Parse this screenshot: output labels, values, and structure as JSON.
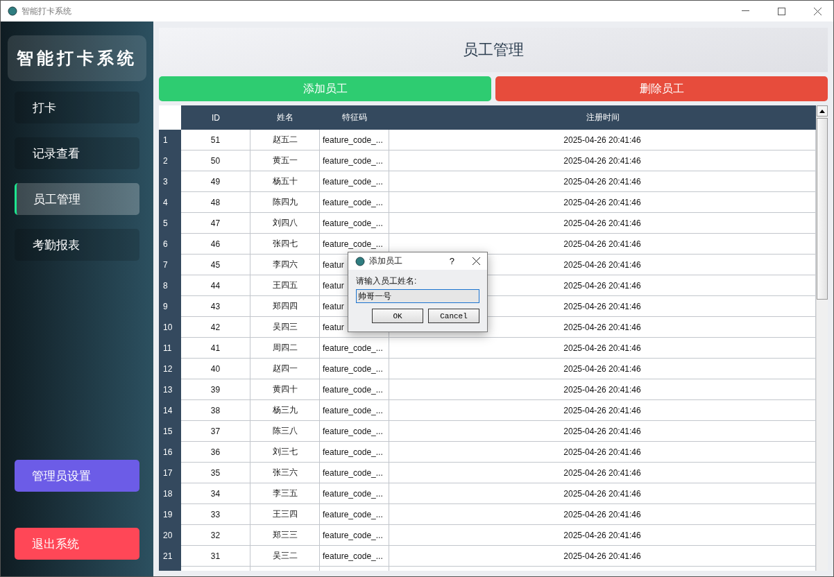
{
  "window": {
    "title": "智能打卡系统"
  },
  "sidebar": {
    "logo": "智能打卡系统",
    "items": [
      {
        "label": "打卡",
        "selected": false
      },
      {
        "label": "记录查看",
        "selected": false
      },
      {
        "label": "员工管理",
        "selected": true
      },
      {
        "label": "考勤报表",
        "selected": false
      }
    ],
    "admin_button": "管理员设置",
    "exit_button": "退出系统"
  },
  "page": {
    "title": "员工管理",
    "add_button": "添加员工",
    "delete_button": "删除员工"
  },
  "table": {
    "columns": [
      "ID",
      "姓名",
      "特征码",
      "注册时间"
    ],
    "rows": [
      {
        "no": "1",
        "id": "51",
        "name": "赵五二",
        "code": "feature_code_...",
        "time": "2025-04-26 20:41:46"
      },
      {
        "no": "2",
        "id": "50",
        "name": "黄五一",
        "code": "feature_code_...",
        "time": "2025-04-26 20:41:46"
      },
      {
        "no": "3",
        "id": "49",
        "name": "杨五十",
        "code": "feature_code_...",
        "time": "2025-04-26 20:41:46"
      },
      {
        "no": "4",
        "id": "48",
        "name": "陈四九",
        "code": "feature_code_...",
        "time": "2025-04-26 20:41:46"
      },
      {
        "no": "5",
        "id": "47",
        "name": "刘四八",
        "code": "feature_code_...",
        "time": "2025-04-26 20:41:46"
      },
      {
        "no": "6",
        "id": "46",
        "name": "张四七",
        "code": "feature_code_...",
        "time": "2025-04-26 20:41:46"
      },
      {
        "no": "7",
        "id": "45",
        "name": "李四六",
        "code": "featur",
        "time": "2025-04-26 20:41:46"
      },
      {
        "no": "8",
        "id": "44",
        "name": "王四五",
        "code": "featur",
        "time": "2025-04-26 20:41:46"
      },
      {
        "no": "9",
        "id": "43",
        "name": "郑四四",
        "code": "featur",
        "time": "2025-04-26 20:41:46"
      },
      {
        "no": "10",
        "id": "42",
        "name": "吴四三",
        "code": "featur",
        "time": "2025-04-26 20:41:46"
      },
      {
        "no": "11",
        "id": "41",
        "name": "周四二",
        "code": "feature_code_...",
        "time": "2025-04-26 20:41:46"
      },
      {
        "no": "12",
        "id": "40",
        "name": "赵四一",
        "code": "feature_code_...",
        "time": "2025-04-26 20:41:46"
      },
      {
        "no": "13",
        "id": "39",
        "name": "黄四十",
        "code": "feature_code_...",
        "time": "2025-04-26 20:41:46"
      },
      {
        "no": "14",
        "id": "38",
        "name": "杨三九",
        "code": "feature_code_...",
        "time": "2025-04-26 20:41:46"
      },
      {
        "no": "15",
        "id": "37",
        "name": "陈三八",
        "code": "feature_code_...",
        "time": "2025-04-26 20:41:46"
      },
      {
        "no": "16",
        "id": "36",
        "name": "刘三七",
        "code": "feature_code_...",
        "time": "2025-04-26 20:41:46"
      },
      {
        "no": "17",
        "id": "35",
        "name": "张三六",
        "code": "feature_code_...",
        "time": "2025-04-26 20:41:46"
      },
      {
        "no": "18",
        "id": "34",
        "name": "李三五",
        "code": "feature_code_...",
        "time": "2025-04-26 20:41:46"
      },
      {
        "no": "19",
        "id": "33",
        "name": "王三四",
        "code": "feature_code_...",
        "time": "2025-04-26 20:41:46"
      },
      {
        "no": "20",
        "id": "32",
        "name": "郑三三",
        "code": "feature_code_...",
        "time": "2025-04-26 20:41:46"
      },
      {
        "no": "21",
        "id": "31",
        "name": "吴三二",
        "code": "feature_code_...",
        "time": "2025-04-26 20:41:46"
      }
    ]
  },
  "dialog": {
    "title": "添加员工",
    "help": "?",
    "label": "请输入员工姓名:",
    "value": "帅哥一号",
    "ok": "OK",
    "cancel": "Cancel"
  }
}
